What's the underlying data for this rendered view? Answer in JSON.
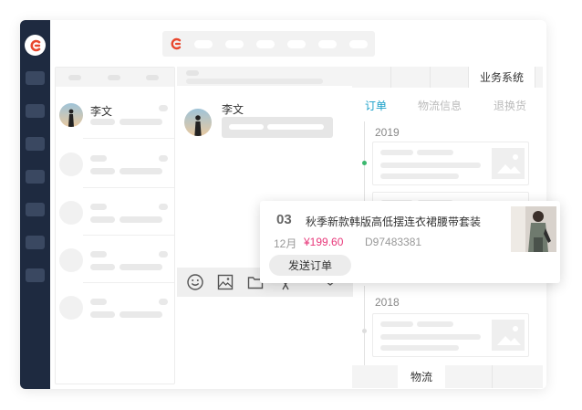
{
  "contacts": {
    "selected_name": "李文"
  },
  "chat": {
    "contact_name": "李文"
  },
  "right_panel": {
    "top_tab_active": "业务系统",
    "subtabs": [
      "订单",
      "物流信息",
      "退换货"
    ],
    "years": [
      "2019",
      "2018"
    ],
    "bottom_tab_active": "物流"
  },
  "order_popup": {
    "number": "03",
    "title": "秋季新款韩版高低摆连衣裙腰带套装",
    "month": "12月",
    "price": "¥199.60",
    "code": "D97483381",
    "send_button": "发送订单"
  },
  "colors": {
    "sidebar": "#1e2a40",
    "brand": "#e8472e",
    "active_subtab": "#1aa0c9",
    "price": "#e8387a",
    "timeline_dot": "#3bb86e"
  },
  "icons": [
    "app-logo-icon",
    "emoji-icon",
    "image-icon",
    "folder-icon",
    "scissors-icon",
    "chevron-down-icon",
    "image-placeholder-icon"
  ]
}
